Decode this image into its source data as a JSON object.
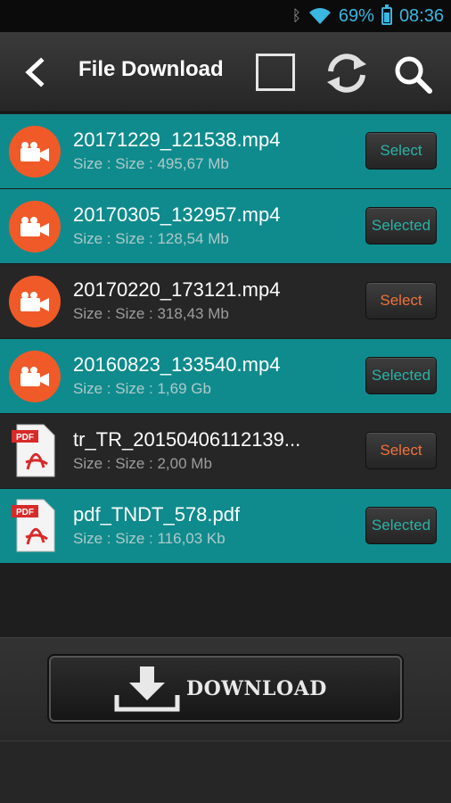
{
  "status": {
    "battery": "69%",
    "time": "08:36",
    "battery_level": 0.69
  },
  "header": {
    "title": "File Download"
  },
  "files": [
    {
      "name": "20171229_121538.mp4",
      "size": "Size : Size : 495,67 Mb",
      "type": "video",
      "selected": true,
      "button": "Select"
    },
    {
      "name": "20170305_132957.mp4",
      "size": "Size : Size : 128,54 Mb",
      "type": "video",
      "selected": true,
      "button": "Selected"
    },
    {
      "name": "20170220_173121.mp4",
      "size": "Size : Size : 318,43 Mb",
      "type": "video",
      "selected": false,
      "button": "Select"
    },
    {
      "name": "20160823_133540.mp4",
      "size": "Size : Size : 1,69 Gb",
      "type": "video",
      "selected": true,
      "button": "Selected"
    },
    {
      "name": "tr_TR_20150406112139...",
      "size": "Size : Size : 2,00 Mb",
      "type": "pdf",
      "selected": false,
      "button": "Select"
    },
    {
      "name": "pdf_TNDT_578.pdf",
      "size": "Size : Size : 116,03 Kb",
      "type": "pdf",
      "selected": true,
      "button": "Selected"
    }
  ],
  "pdf_badge": "PDF",
  "download": {
    "label": "DOWNLOAD"
  },
  "colors": {
    "teal_row": "#0f8b8d",
    "dark_row": "#262626",
    "video_icon": "#f05a28",
    "status_accent": "#3ab7e0"
  }
}
